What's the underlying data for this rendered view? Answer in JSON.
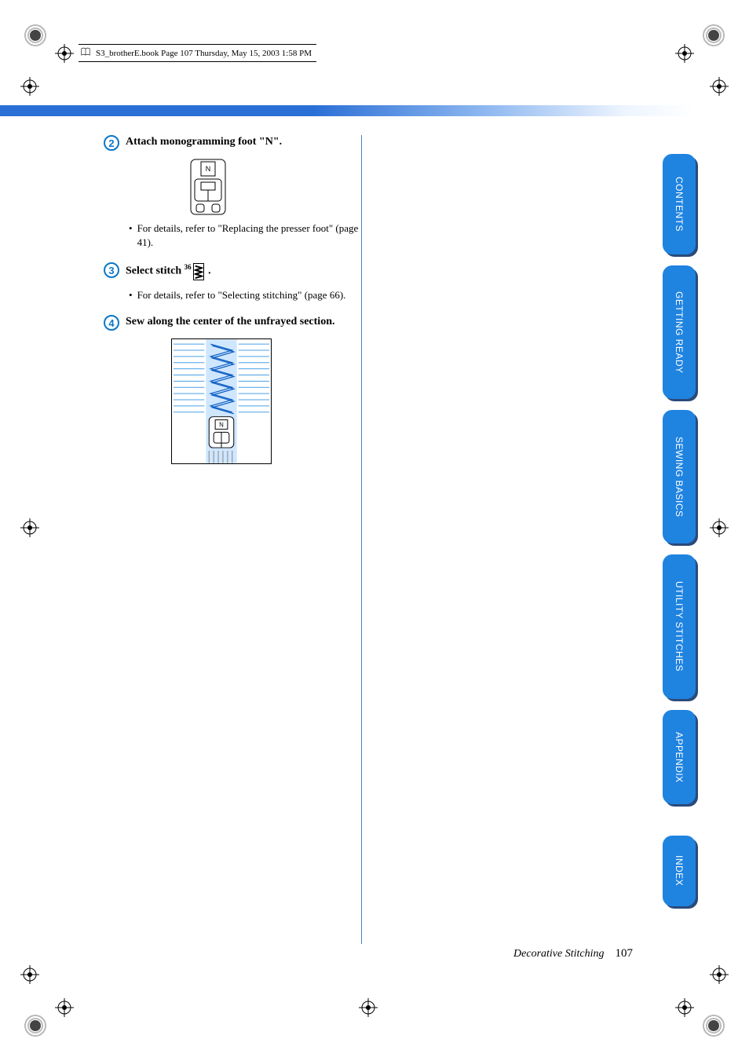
{
  "header": {
    "book_line": "S3_brotherE.book  Page 107  Thursday, May 15, 2003  1:58 PM"
  },
  "steps": {
    "s2": {
      "num": "2",
      "title": "Attach monogramming foot \"N\".",
      "bullet": "For details, refer to \"Replacing the presser foot\" (page 41)."
    },
    "s3": {
      "num": "3",
      "title_prefix": "Select stitch ",
      "title_sup": "36",
      "title_suffix": " .",
      "bullet": "For details, refer to \"Selecting stitching\" (page 66)."
    },
    "s4": {
      "num": "4",
      "title": "Sew along the center of the unfrayed section."
    }
  },
  "tabs": {
    "t1": "CONTENTS",
    "t2": "GETTING READY",
    "t3": "SEWING BASICS",
    "t4": "UTILITY STITCHES",
    "t5": "APPENDIX",
    "t6": "INDEX"
  },
  "footer": {
    "section": "Decorative Stitching",
    "page": "107"
  }
}
